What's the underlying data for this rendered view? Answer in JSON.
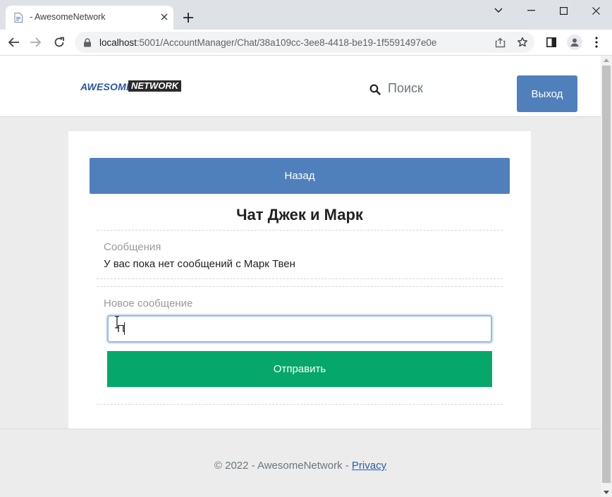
{
  "browser": {
    "tab_title": "- AwesomeNetwork",
    "url_host": "localhost",
    "url_rest": ":5001/AccountManager/Chat/38a109cc-3ee8-4418-be19-1f5591497e0e"
  },
  "header": {
    "logo_part1": "AWESOME",
    "logo_part2": "NETWORK",
    "search_label": "Поиск",
    "logout_label": "Выход"
  },
  "chat": {
    "back_label": "Назад",
    "title": "Чат Джек и Марк",
    "messages_label": "Сообщения",
    "no_messages_text": "У вас пока нет сообщений с Марк Твен",
    "new_message_label": "Новое сообщение",
    "input_value": "П",
    "send_label": "Отправить"
  },
  "footer": {
    "text": "© 2022 - AwesomeNetwork - ",
    "privacy_link": "Privacy"
  },
  "colors": {
    "primary": "#5080bb",
    "success": "#05a86a",
    "page_bg": "#ececec"
  }
}
